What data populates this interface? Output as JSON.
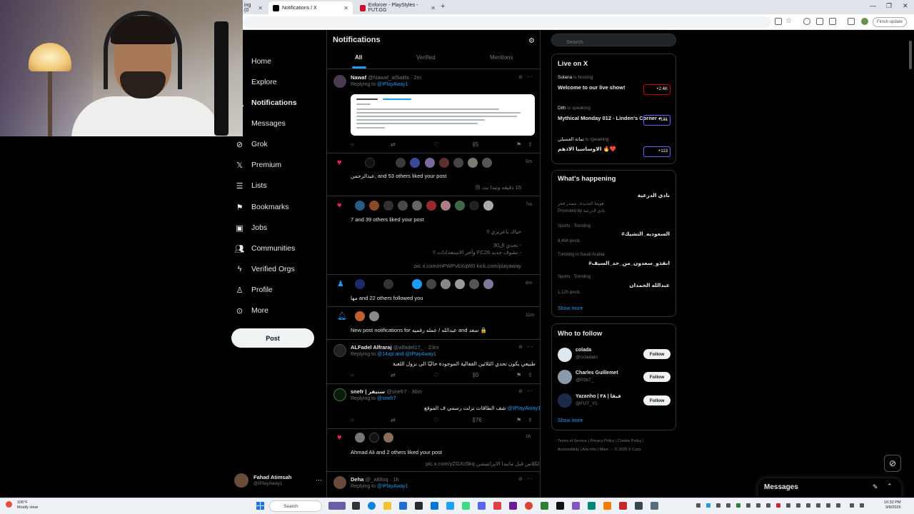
{
  "browser": {
    "tabs": [
      {
        "label": "ing (0"
      },
      {
        "label": "Notifications / X"
      },
      {
        "label": "Enforcer - PlayStyles - FUT.GG"
      }
    ],
    "finish_update": "Finish update"
  },
  "nav": {
    "items": [
      {
        "label": "Home",
        "icon": "home-icon"
      },
      {
        "label": "Explore",
        "icon": "search-icon"
      },
      {
        "label": "Notifications",
        "icon": "bell-icon"
      },
      {
        "label": "Messages",
        "icon": "envelope-icon"
      },
      {
        "label": "Grok",
        "icon": "grok-icon"
      },
      {
        "label": "Premium",
        "icon": "x-icon"
      },
      {
        "label": "Lists",
        "icon": "list-icon"
      },
      {
        "label": "Bookmarks",
        "icon": "bookmark-icon"
      },
      {
        "label": "Jobs",
        "icon": "briefcase-icon"
      },
      {
        "label": "Communities",
        "icon": "people-icon"
      },
      {
        "label": "Verified Orgs",
        "icon": "lightning-icon"
      },
      {
        "label": "Profile",
        "icon": "person-icon"
      },
      {
        "label": "More",
        "icon": "more-circle-icon"
      }
    ],
    "post_label": "Post",
    "account": {
      "name": "Fahad Atimsah",
      "handle": "@IPlayAway1"
    }
  },
  "main": {
    "title": "Notifications",
    "tabs": [
      "All",
      "Verified",
      "Mentions"
    ],
    "items": {
      "nawaf": {
        "name": "Nawaf",
        "meta": "@Nawaf_alSalifa · 2m",
        "replying": "Replying to",
        "mention": "@IPlayAway1",
        "stat": "5"
      },
      "like1": {
        "text": "عبدالرحمن, and 53 others liked your post",
        "quote": "15 دقيقه وتبدا بث 😢",
        "time": "5m"
      },
      "like2": {
        "text": "7 and 39 others liked your post",
        "line1": "حياك ياعزيزي !!",
        "line2": "- تحدي ال30",
        "line3": "- تشوف جديد FC26 وأخر الاستعدادات !!",
        "link": "pic.x.com/mPWPvbXqW0 kick.com/playaway",
        "time": "7m"
      },
      "follow": {
        "text": "مها and 22 others followed you",
        "time": "8m"
      },
      "newpost": {
        "text": "New post notifications for عبدالله / عمله رقميه and سعد 🔒",
        "time": "11m"
      },
      "alfadel": {
        "name": "ALFadel Alfraraj",
        "meta": "@alfadel17_ · 23m",
        "replying": "Replying to",
        "mention": "@14xpl and @IPlayAway1",
        "body": "طبيعي يكون تحدي الثلاثين الفعالية الموجودة حاليًا الى نزول اللعبة",
        "stat": "0"
      },
      "snefr": {
        "name": "snefr | سنيفر",
        "meta": "@snefr7 · 36m",
        "replying": "Replying to",
        "mention": "@snefr7",
        "body": "شف الطاقات نزلت رسمي ف الموقع",
        "body_mention": "@IPlayAway1",
        "stat": "76"
      },
      "like3": {
        "text": "Ahmad Ali and 2 others liked your post",
        "quote": "الكلاس قبل ماتبدا الايرانتيشن",
        "link": "pic.x.com/yZGXc5kq",
        "time": "1h"
      },
      "deha": {
        "name": "Deha",
        "meta": "@_a88xq · 1h",
        "replying": "Replying to",
        "mention": "@IPlayAway1"
      }
    }
  },
  "right": {
    "search_placeholder": "Search",
    "live": {
      "title": "Live on X",
      "spaces": [
        {
          "host": "Solana",
          "status": "is hosting",
          "title": "Welcome to our live show!",
          "count": "+2.4K"
        },
        {
          "host": "Dith",
          "status": "is speaking",
          "title": "Mythical Monday 012 - Linden's Corner + ...",
          "count": "+131"
        },
        {
          "host": "ثماثة العسيلي",
          "status": "is speaking",
          "title": "الاوساسيا الاذهم 🔥❤️",
          "count": "+113"
        }
      ]
    },
    "happening": {
      "title": "What's happening",
      "promo_name": "نادي الدرعية",
      "promo_line": "هويتنا الجديدة.. مصدر فخر",
      "promo_by": "Promoted by نادي الدرعية",
      "trends": [
        {
          "meta": "Sports · Trending",
          "name": "#السعوديه_التشيك",
          "posts": "8,494 posts"
        },
        {
          "meta": "Trending in Saudi Arabia",
          "name": "#انقذو_سعدون_من_حد_السيف",
          "posts": ""
        },
        {
          "meta": "Sports · Trending",
          "name": "عبدالله الحمدان",
          "posts": "1,120 posts"
        }
      ],
      "show_more": "Show more"
    },
    "who_to_follow": {
      "title": "Who to follow",
      "users": [
        {
          "name": "colada",
          "handle": "@coladalo"
        },
        {
          "name": "Charles Guillemet",
          "handle": "@P3b7_"
        },
        {
          "name": "Yazanho | ۳۸ | قيقا",
          "handle": "@FUT_Y1"
        }
      ],
      "follow_label": "Follow",
      "show_more": "Show more"
    },
    "footer": {
      "line1": "Terms of Service | Privacy Policy | Cookie Policy |",
      "line2": "Accessibility | Ads info | More ··· © 2025 X Corp."
    }
  },
  "messages": {
    "title": "Messages"
  },
  "taskbar": {
    "weather_temp": "106°F",
    "weather_desc": "Mostly clear",
    "search": "Search",
    "time": "10:32 PM",
    "date": "9/8/2025"
  }
}
